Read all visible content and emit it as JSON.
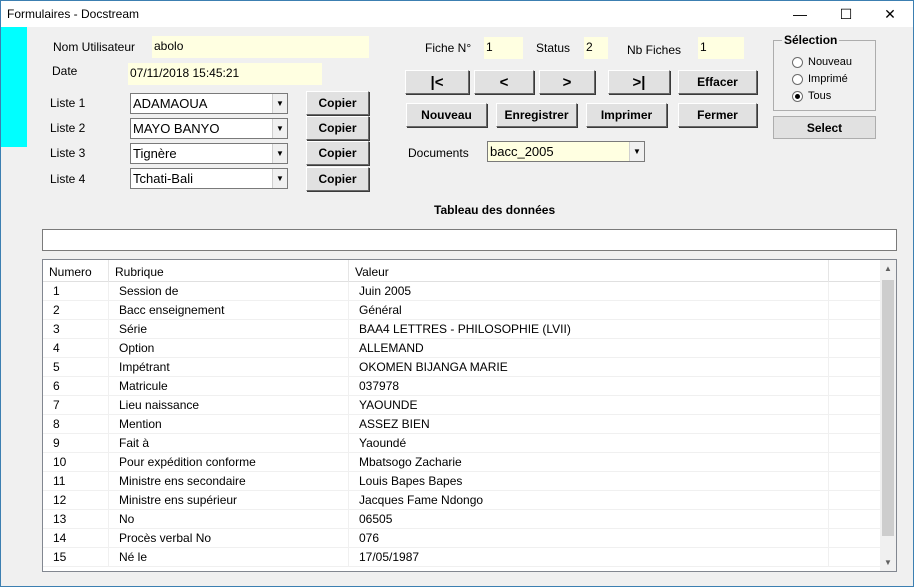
{
  "window": {
    "title": "Formulaires - Docstream",
    "minimize_glyph": "—",
    "maximize_glyph": "☐",
    "close_glyph": "✕"
  },
  "user": {
    "name_label": "Nom Utilisateur",
    "name_value": "abolo",
    "date_label": "Date",
    "date_value": "07/11/2018 15:45:21"
  },
  "lists": [
    {
      "label": "Liste 1",
      "value": "ADAMAOUA",
      "copy_label": "Copier"
    },
    {
      "label": "Liste 2",
      "value": "MAYO BANYO",
      "copy_label": "Copier"
    },
    {
      "label": "Liste 3",
      "value": "Tignère",
      "copy_label": "Copier"
    },
    {
      "label": "Liste 4",
      "value": "Tchati-Bali",
      "copy_label": "Copier"
    }
  ],
  "record": {
    "fiche_label": "Fiche N°",
    "fiche_value": "1",
    "status_label": "Status",
    "status_value": "2",
    "nb_label": "Nb Fiches",
    "nb_value": "1"
  },
  "nav": {
    "first": "|<",
    "prev": "<",
    "next": ">",
    "last": ">|",
    "clear": "Effacer"
  },
  "actions": {
    "new": "Nouveau",
    "save": "Enregistrer",
    "print": "Imprimer",
    "close": "Fermer"
  },
  "documents": {
    "label": "Documents",
    "value": "bacc_2005"
  },
  "selection": {
    "title": "Sélection",
    "options": [
      "Nouveau",
      "Imprimé",
      "Tous"
    ],
    "selected": "Tous",
    "select_button": "Select"
  },
  "table": {
    "title": "Tableau des données",
    "columns": [
      "Numero",
      "Rubrique",
      "Valeur"
    ],
    "rows": [
      [
        "1",
        "Session de",
        "Juin 2005"
      ],
      [
        "2",
        "Bacc enseignement",
        "Général"
      ],
      [
        "3",
        "Série",
        "BAA4 LETTRES - PHILOSOPHIE (LVII)"
      ],
      [
        "4",
        "Option",
        "ALLEMAND"
      ],
      [
        "5",
        "Impétrant",
        "OKOMEN BIJANGA MARIE"
      ],
      [
        "6",
        "Matricule",
        "037978"
      ],
      [
        "7",
        "Lieu naissance",
        "YAOUNDE"
      ],
      [
        "8",
        "Mention",
        "ASSEZ BIEN"
      ],
      [
        "9",
        "Fait à",
        "Yaoundé"
      ],
      [
        "10",
        "Pour expédition conforme",
        "Mbatsogo Zacharie"
      ],
      [
        "11",
        "Ministre ens secondaire",
        "Louis Bapes Bapes"
      ],
      [
        "12",
        "Ministre ens supérieur",
        "Jacques Fame Ndongo"
      ],
      [
        "13",
        "No",
        "06505"
      ],
      [
        "14",
        "Procès verbal No",
        "076"
      ],
      [
        "15",
        "Né le",
        "17/05/1987"
      ]
    ]
  }
}
